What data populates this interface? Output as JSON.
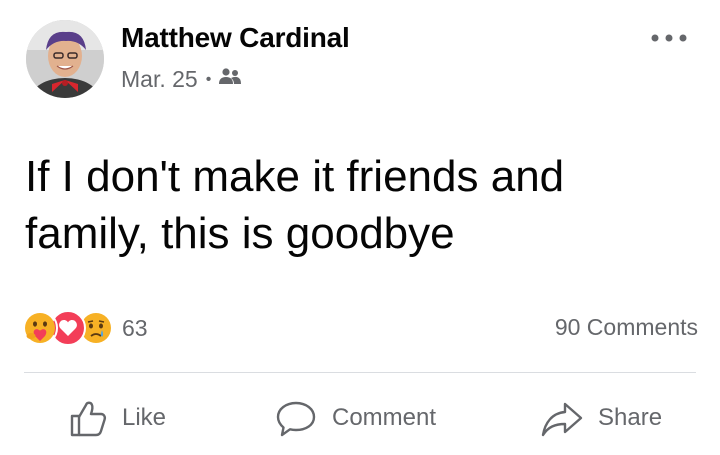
{
  "post": {
    "author_name": "Matthew Cardinal",
    "date": "Mar. 25",
    "separator": "•",
    "audience_icon": "friends-icon",
    "more_icon": "more-horizontal-icon",
    "text": "If I don't make it friends and\nfamily, this is goodbye"
  },
  "engagement": {
    "reaction_icons": [
      "care-emoji-icon",
      "love-heart-icon",
      "sad-emoji-icon"
    ],
    "reaction_count": "63",
    "comments_label": "90 Comments"
  },
  "actions": {
    "like_label": "Like",
    "comment_label": "Comment",
    "share_label": "Share"
  },
  "colors": {
    "text_primary": "#050505",
    "text_secondary": "#65676b",
    "love_red": "#f33e58",
    "emoji_yellow": "#f7b125",
    "divider": "#dadde1"
  }
}
